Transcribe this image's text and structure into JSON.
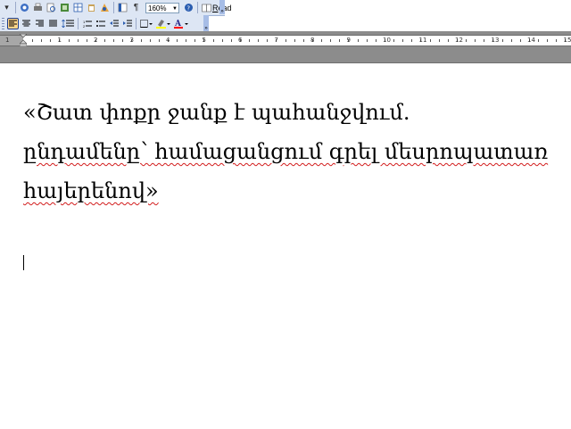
{
  "toolbar": {
    "zoom_level": "160%",
    "read_label": "Read",
    "read_underlined": "R",
    "read_rest": "ead"
  },
  "ruler": {
    "numbers": [
      "1",
      "1",
      "2",
      "3",
      "4",
      "5",
      "6",
      "7",
      "8",
      "9",
      "10",
      "11",
      "12",
      "13",
      "14",
      "15"
    ]
  },
  "document": {
    "lines": [
      "«Շատ փոքր ջանք է պահանջվում.",
      "ընդամենը՝ համացանցում գրել մեսրոպատառ",
      "հայերենով»"
    ]
  },
  "colors": {
    "toolbar_bg": "#dde6f4",
    "spell_underline": "#d21c1c",
    "highlighter": "#ffff00",
    "font_color": "#ff0000"
  }
}
